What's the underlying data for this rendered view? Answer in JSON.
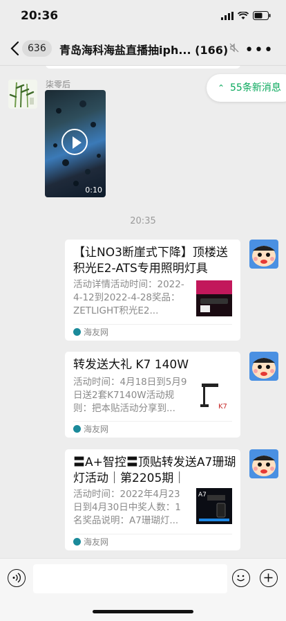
{
  "status": {
    "time": "20:36"
  },
  "nav": {
    "unread_badge": "636",
    "title": "青岛海科海盐直播抽iph... (166)"
  },
  "chat": {
    "sender_name": "柒零后",
    "video_duration": "0:10",
    "new_messages": "55条新消息",
    "timestamp": "20:35",
    "cards": [
      {
        "title": "【让NO3断崖式下降】顶楼送积光E2-ATS专用照明灯具",
        "desc": "活动详情活动时间：2022-4-12到2022-4-28奖品：ZETLIGHT积光E2...",
        "source": "海友网"
      },
      {
        "title": "转发送大礼 K7 140W",
        "desc": "活动时间：4月18日到5月9日送2套K7140W活动规则：把本贴活动分享到...",
        "source": "海友网"
      },
      {
        "title": "〓A+智控〓顶贴转发送A7珊瑚灯活动｜第2205期｜",
        "desc": "活动时间：2022年4月23日到4月30日中奖人数：1名奖品说明：A7珊瑚灯...",
        "source": "海友网"
      }
    ]
  },
  "colors": {
    "accent": "#07a85b",
    "background": "#ededed"
  }
}
